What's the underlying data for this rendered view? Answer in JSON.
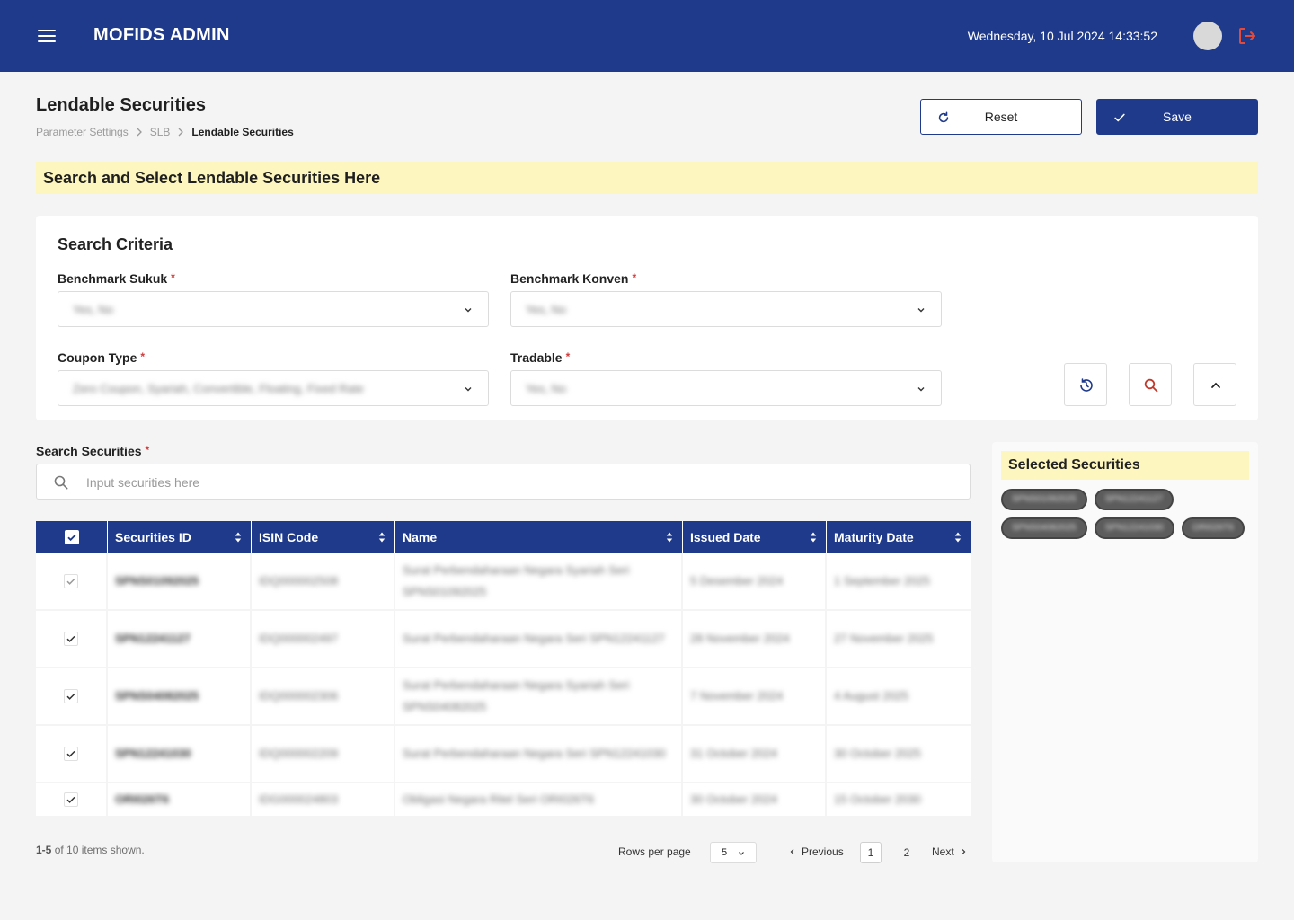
{
  "app": {
    "title": "MOFIDS ADMIN",
    "datetime": "Wednesday, 10 Jul 2024 14:33:52",
    "colors": {
      "primary": "#1f3a8a",
      "highlight": "#fdf6bf",
      "required": "#d23b3b",
      "logout": "#e24b3b"
    }
  },
  "page": {
    "title": "Lendable Securities",
    "breadcrumb": [
      "Parameter Settings",
      "SLB",
      "Lendable Securities"
    ],
    "reset_label": "Reset",
    "save_label": "Save",
    "banner": "Search and Select Lendable Securities Here"
  },
  "criteria": {
    "title": "Search Criteria",
    "benchmark_sukuk": {
      "label": "Benchmark Sukuk",
      "value": "Yes, No"
    },
    "benchmark_konven": {
      "label": "Benchmark Konven",
      "value": "Yes, No"
    },
    "coupon_type": {
      "label": "Coupon Type",
      "value": "Zero Coupon, Syariah, Convertible, Floating, Fixed Rate"
    },
    "tradable": {
      "label": "Tradable",
      "value": "Yes, No"
    },
    "required_mark": "*"
  },
  "search": {
    "label": "Search Securities",
    "placeholder": "Input securities here"
  },
  "table": {
    "headers": [
      "Securities ID",
      "ISIN Code",
      "Name",
      "Issued Date",
      "Maturity Date"
    ],
    "rows": [
      {
        "id": "SPNS01092025",
        "isin": "IDQ000002508",
        "name": "Surat Perbendaharaan Negara Syariah Seri SPNS01092025",
        "issued": "5 Desember 2024",
        "maturity": "1 September 2025"
      },
      {
        "id": "SPN12241127",
        "isin": "IDQ000002497",
        "name": "Surat Perbendaharaan Negara Seri SPN12241127",
        "issued": "28 November 2024",
        "maturity": "27 November 2025"
      },
      {
        "id": "SPNS04082025",
        "isin": "IDQ000002306",
        "name": "Surat Perbendaharaan Negara Syariah Seri SPNS04082025",
        "issued": "7 November 2024",
        "maturity": "4 August 2025"
      },
      {
        "id": "SPN12241030",
        "isin": "IDQ000002209",
        "name": "Surat Perbendaharaan Negara Seri SPN12241030",
        "issued": "31 October 2024",
        "maturity": "30 October 2025"
      },
      {
        "id": "ORI026T6",
        "isin": "IDG000024803",
        "name": "Obligasi Negara Ritel Seri ORI026T6",
        "issued": "30 October 2024",
        "maturity": "15 October 2030"
      }
    ]
  },
  "pagination": {
    "shown_range": "1-5",
    "shown_rest": "of 10 items shown.",
    "rows_per_page_label": "Rows per page",
    "rows_per_page": "5",
    "previous": "Previous",
    "pages": [
      "1",
      "2"
    ],
    "current_page": "1",
    "next": "Next"
  },
  "selected": {
    "title": "Selected Securities",
    "items": [
      "SPNS01092025",
      "SPN12241127",
      "SPNS04082025",
      "SPN12241030",
      "ORI026T6"
    ]
  },
  "icons": {
    "menu": "hamburger-icon",
    "logout": "logout-icon",
    "reset": "refresh-icon",
    "save": "check-icon",
    "dropdown": "chevron-down-icon",
    "reset_filter": "history-icon",
    "search": "search-icon",
    "collapse": "chevron-up-icon",
    "sort": "sort-icon"
  }
}
